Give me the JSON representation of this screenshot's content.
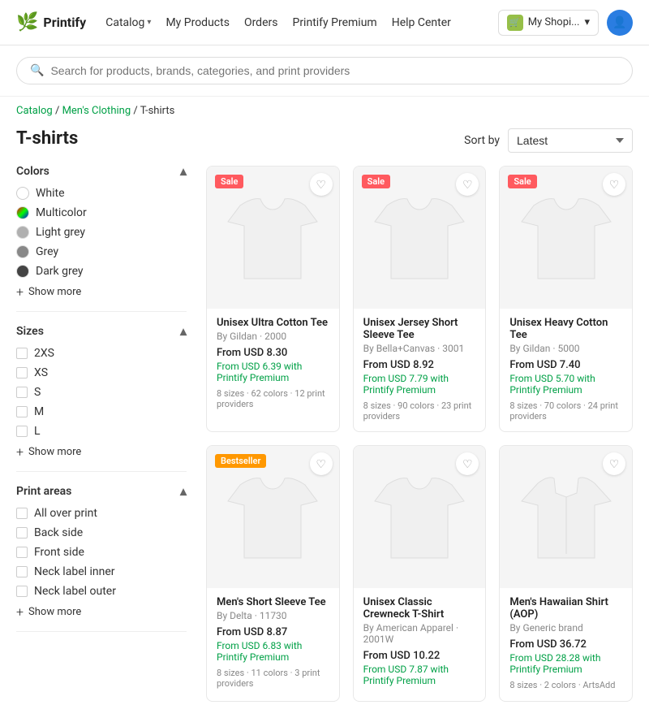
{
  "header": {
    "logo_text": "Printify",
    "logo_icon": "🌿",
    "nav": [
      {
        "label": "Catalog",
        "has_dropdown": true
      },
      {
        "label": "My Products"
      },
      {
        "label": "Orders"
      },
      {
        "label": "Printify Premium"
      },
      {
        "label": "Help Center"
      }
    ],
    "shop_name": "My Shopi...",
    "shop_icon": "🛒"
  },
  "search": {
    "placeholder": "Search for products, brands, categories, and print providers"
  },
  "breadcrumb": {
    "items": [
      "Catalog",
      "Men's Clothing",
      "T-shirts"
    ]
  },
  "page": {
    "title": "T-shirts"
  },
  "sort": {
    "label": "Sort by",
    "value": "Latest"
  },
  "sidebar": {
    "colors_section": {
      "label": "Colors",
      "items": [
        {
          "label": "White",
          "color": "#ffffff",
          "border": "#ddd"
        },
        {
          "label": "Multicolor",
          "color": "linear-gradient(135deg,red,blue,green)",
          "is_gradient": true
        },
        {
          "label": "Light grey",
          "color": "#c0c0c0"
        },
        {
          "label": "Grey",
          "color": "#888888"
        },
        {
          "label": "Dark grey",
          "color": "#444444"
        }
      ],
      "show_more": "Show more"
    },
    "sizes_section": {
      "label": "Sizes",
      "items": [
        "2XS",
        "XS",
        "S",
        "M",
        "L"
      ],
      "show_more": "Show more"
    },
    "print_areas_section": {
      "label": "Print areas",
      "items": [
        "All over print",
        "Back side",
        "Front side",
        "Neck label inner",
        "Neck label outer"
      ],
      "show_more": "Show more"
    }
  },
  "products": [
    {
      "id": 1,
      "name": "Unisex Ultra Cotton Tee",
      "brand": "By Gildan · 2000",
      "price": "From USD 8.30",
      "premium_price": "From USD 6.39 with Printify Premium",
      "meta": "8 sizes · 62 colors · 12 print providers",
      "badge": "Sale",
      "badge_type": "sale"
    },
    {
      "id": 2,
      "name": "Unisex Jersey Short Sleeve Tee",
      "brand": "By Bella+Canvas · 3001",
      "price": "From USD 8.92",
      "premium_price": "From USD 7.79 with Printify Premium",
      "meta": "8 sizes · 90 colors · 23 print providers",
      "badge": "Sale",
      "badge_type": "sale"
    },
    {
      "id": 3,
      "name": "Unisex Heavy Cotton Tee",
      "brand": "By Gildan · 5000",
      "price": "From USD 7.40",
      "premium_price": "From USD 5.70 with Printify Premium",
      "meta": "8 sizes · 70 colors · 24 print providers",
      "badge": "Sale",
      "badge_type": "sale"
    },
    {
      "id": 4,
      "name": "Men's Short Sleeve Tee",
      "brand": "By Delta · 11730",
      "price": "From USD 8.87",
      "premium_price": "From USD 6.83 with Printify Premium",
      "meta": "8 sizes · 11 colors · 3 print providers",
      "badge": "Bestseller",
      "badge_type": "bestseller"
    },
    {
      "id": 5,
      "name": "Unisex Classic Crewneck T-Shirt",
      "brand": "By American Apparel · 2001W",
      "price": "From USD 10.22",
      "premium_price": "From USD 7.87 with Printify Premium",
      "meta": "",
      "badge": "",
      "badge_type": ""
    },
    {
      "id": 6,
      "name": "Men's Hawaiian Shirt (AOP)",
      "brand": "By Generic brand",
      "price": "From USD 36.72",
      "premium_price": "From USD 28.28 with Printify Premium",
      "meta": "8 sizes · 2 colors · ArtsAdd",
      "badge": "",
      "badge_type": ""
    }
  ],
  "icons": {
    "search": "🔍",
    "heart": "♡",
    "chevron_down": "▾",
    "chevron_up": "▴",
    "plus": "+",
    "user": "👤"
  }
}
